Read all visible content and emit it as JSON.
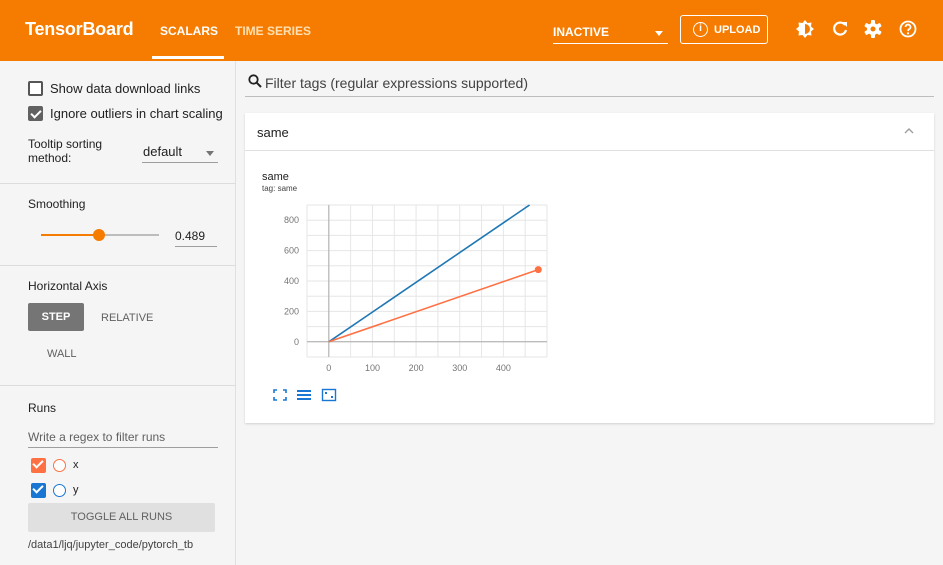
{
  "topbar": {
    "brand": "TensorBoard",
    "tabs": [
      {
        "label": "SCALARS",
        "active": true
      },
      {
        "label": "TIME SERIES",
        "active": false
      }
    ],
    "run_state": "INACTIVE",
    "upload_label": "UPLOAD",
    "icons": [
      "theme-toggle-icon",
      "reload-icon",
      "settings-icon",
      "help-icon"
    ],
    "color": "#f57c00"
  },
  "sidebar": {
    "show_download_links": {
      "label": "Show data download links",
      "checked": false
    },
    "ignore_outliers": {
      "label": "Ignore outliers in chart scaling",
      "checked": true
    },
    "tooltip_sort": {
      "label_line1": "Tooltip sorting",
      "label_line2": "method:",
      "value": "default"
    },
    "smoothing": {
      "label": "Smoothing",
      "value": "0.489",
      "fraction": 0.489
    },
    "horizontal_axis": {
      "label": "Horizontal Axis",
      "options": [
        "STEP",
        "RELATIVE",
        "WALL"
      ],
      "selected": "STEP"
    },
    "runs": {
      "label": "Runs",
      "filter_placeholder": "Write a regex to filter runs",
      "items": [
        {
          "name": "x",
          "color": "#ff7043",
          "checked": true
        },
        {
          "name": "y",
          "color": "#1976d2",
          "checked": true
        }
      ],
      "toggle_label": "TOGGLE ALL RUNS",
      "logdir": "/data1/ljq/jupyter_code/pytorch_tb"
    }
  },
  "main": {
    "filter_placeholder": "Filter tags (regular expressions supported)",
    "card": {
      "title": "same",
      "chart_title": "same",
      "chart_tag": "tag: same"
    }
  },
  "chart_data": {
    "type": "line",
    "xlim": [
      -50,
      500
    ],
    "ylim": [
      -100,
      900
    ],
    "xticks": [
      0,
      100,
      200,
      300,
      400
    ],
    "yticks": [
      0,
      200,
      400,
      600,
      800
    ],
    "grid": true,
    "series": [
      {
        "name": "y",
        "color": "#1f77b4",
        "x": [
          0,
          460
        ],
        "y": [
          0,
          900
        ]
      },
      {
        "name": "x",
        "color": "#ff7043",
        "x": [
          0,
          480
        ],
        "y": [
          0,
          475
        ],
        "end_marker": true
      }
    ]
  }
}
